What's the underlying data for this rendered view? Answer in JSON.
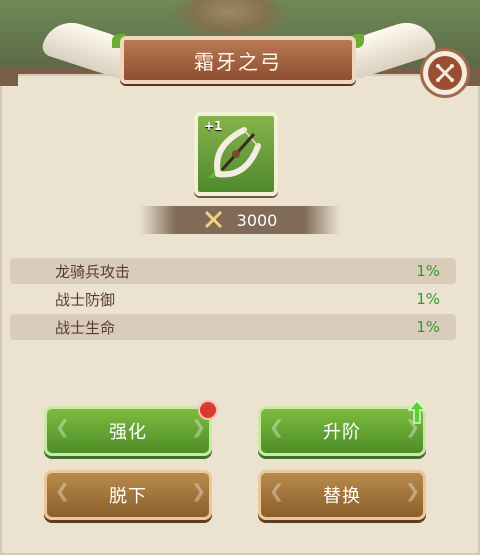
{
  "title": "霜牙之弓",
  "item": {
    "level_badge": "+1",
    "icon": "bow-icon"
  },
  "power": {
    "icon": "crossed-swords-icon",
    "value": "3000"
  },
  "stats": [
    {
      "name": "龙骑兵攻击",
      "value": "1%"
    },
    {
      "name": "战士防御",
      "value": "1%"
    },
    {
      "name": "战士生命",
      "value": "1%"
    }
  ],
  "buttons": {
    "enhance": "强化",
    "upgrade": "升阶",
    "unequip": "脱下",
    "replace": "替换"
  },
  "colors": {
    "stat_value": "#2c9d2a",
    "green_button": "#5e9f2f",
    "brown_button": "#9a6c33",
    "notification": "#d83a30"
  }
}
